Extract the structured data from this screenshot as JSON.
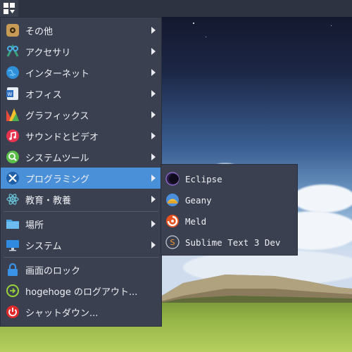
{
  "menu": {
    "items": [
      {
        "label": "その他",
        "icon": "other-icon",
        "has_submenu": true
      },
      {
        "label": "アクセサリ",
        "icon": "accessories-icon",
        "has_submenu": true
      },
      {
        "label": "インターネット",
        "icon": "internet-icon",
        "has_submenu": true
      },
      {
        "label": "オフィス",
        "icon": "office-icon",
        "has_submenu": true
      },
      {
        "label": "グラフィックス",
        "icon": "graphics-icon",
        "has_submenu": true
      },
      {
        "label": "サウンドとビデオ",
        "icon": "music-icon",
        "has_submenu": true
      },
      {
        "label": "システムツール",
        "icon": "system-tools-icon",
        "has_submenu": true
      },
      {
        "label": "プログラミング",
        "icon": "programming-icon",
        "has_submenu": true,
        "selected": true
      },
      {
        "label": "教育・教養",
        "icon": "education-icon",
        "has_submenu": true
      }
    ],
    "places": [
      {
        "label": "場所",
        "icon": "folder-icon",
        "has_submenu": true
      },
      {
        "label": "システム",
        "icon": "monitor-icon",
        "has_submenu": true
      }
    ],
    "session": [
      {
        "label": "画面のロック",
        "icon": "lock-icon"
      },
      {
        "label": "hogehoge のログアウト...",
        "icon": "logout-icon"
      },
      {
        "label": "シャットダウン...",
        "icon": "power-icon"
      }
    ]
  },
  "submenu": {
    "items": [
      {
        "label": "Eclipse",
        "icon": "eclipse-icon"
      },
      {
        "label": "Geany",
        "icon": "geany-icon"
      },
      {
        "label": "Meld",
        "icon": "meld-icon"
      },
      {
        "label": "Sublime Text 3 Dev",
        "icon": "sublime-text-icon"
      }
    ]
  },
  "colors": {
    "panel": "#2e3341",
    "menu_bg": "#3b4050",
    "selection": "#4a90d9"
  }
}
